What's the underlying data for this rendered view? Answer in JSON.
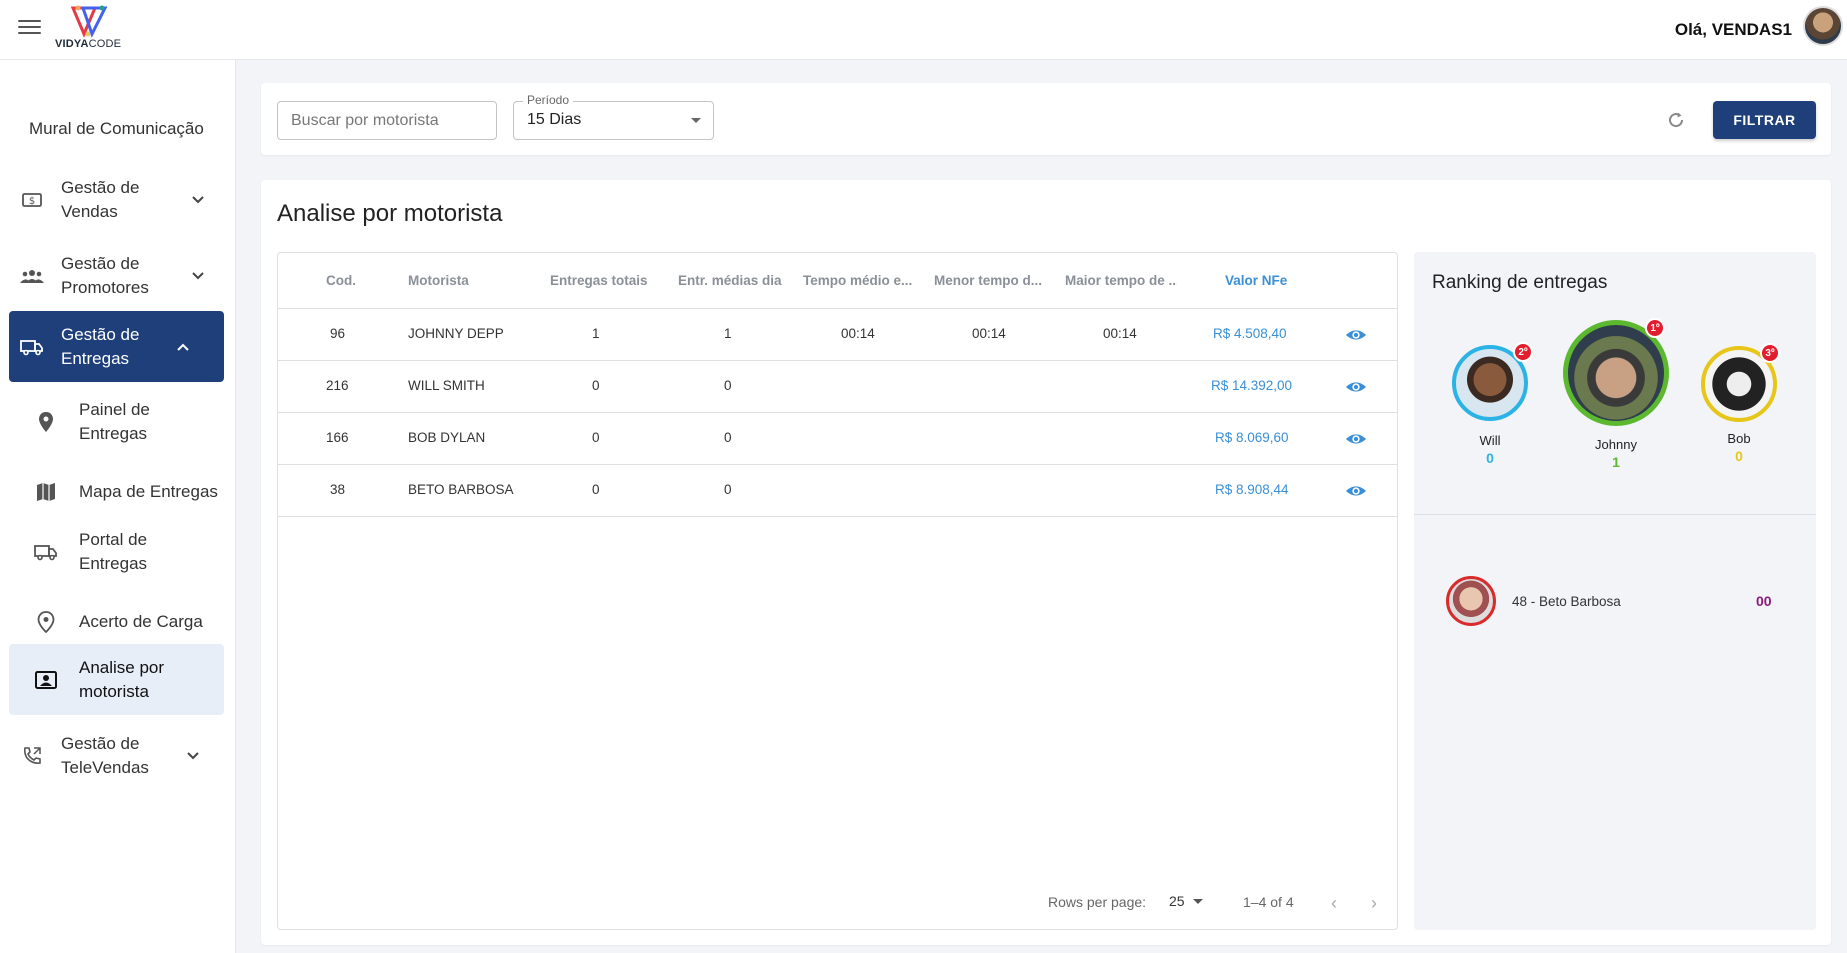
{
  "header": {
    "brand_part1": "VIDYA",
    "brand_part2": "CODE",
    "greeting": "Olá, VENDAS1"
  },
  "sidebar": {
    "mural": "Mural de Comunicação",
    "items": [
      {
        "label": "Gestão de Vendas",
        "icon": "dollar-icon"
      },
      {
        "label": "Gestão de Promotores",
        "icon": "people-icon"
      },
      {
        "label": "Gestão de Entregas",
        "icon": "truck-icon"
      },
      {
        "label": "Painel de Entregas",
        "icon": "pin-icon"
      },
      {
        "label": "Mapa de Entregas",
        "icon": "map-icon"
      },
      {
        "label": "Portal de Entregas",
        "icon": "truck-icon"
      },
      {
        "label": "Acerto de Carga",
        "icon": "location-icon"
      },
      {
        "label": "Analise por motorista",
        "icon": "badge-icon"
      },
      {
        "label": "Gestão de TeleVendas",
        "icon": "phone-icon"
      }
    ]
  },
  "filters": {
    "search_placeholder": "Buscar por motorista",
    "period_label": "Período",
    "period_value": "15 Dias",
    "filter_button": "FILTRAR"
  },
  "main": {
    "title": "Analise por motorista",
    "columns": [
      "Cod.",
      "Motorista",
      "Entregas totais",
      "Entr. médias dia",
      "Tempo médio e...",
      "Menor tempo d...",
      "Maior tempo de ...",
      "Valor NFe"
    ],
    "rows": [
      {
        "cod": "96",
        "motorista": "JOHNNY DEPP",
        "totais": "1",
        "medias": "1",
        "tempo_medio": "00:14",
        "menor": "00:14",
        "maior": "00:14",
        "valor": "R$ 4.508,40"
      },
      {
        "cod": "216",
        "motorista": "WILL SMITH",
        "totais": "0",
        "medias": "0",
        "tempo_medio": "",
        "menor": "",
        "maior": "",
        "valor": "R$ 14.392,00"
      },
      {
        "cod": "166",
        "motorista": "BOB DYLAN",
        "totais": "0",
        "medias": "0",
        "tempo_medio": "",
        "menor": "",
        "maior": "",
        "valor": "R$ 8.069,60"
      },
      {
        "cod": "38",
        "motorista": "BETO BARBOSA",
        "totais": "0",
        "medias": "0",
        "tempo_medio": "",
        "menor": "",
        "maior": "",
        "valor": "R$ 8.908,44"
      }
    ],
    "pagination": {
      "rows_per_page_label": "Rows per page:",
      "rows_per_page": "25",
      "range": "1–4 of 4"
    }
  },
  "ranking": {
    "title": "Ranking de entregas",
    "podium": [
      {
        "name": "Will",
        "value": "0",
        "badge": "2º",
        "color": "#2bb3e6"
      },
      {
        "name": "Johnny",
        "value": "1",
        "badge": "1º",
        "color": "#5cb82e"
      },
      {
        "name": "Bob",
        "value": "0",
        "badge": "3º",
        "color": "#e6c619"
      }
    ],
    "others": [
      {
        "label": "48 - Beto Barbosa",
        "value": "00"
      }
    ]
  },
  "colors": {
    "primary": "#1e3f7a",
    "link": "#3a8fd6",
    "first": "#5cb82e",
    "second": "#2bb3e6",
    "third": "#e6c619",
    "other": "#8b1a7a"
  }
}
